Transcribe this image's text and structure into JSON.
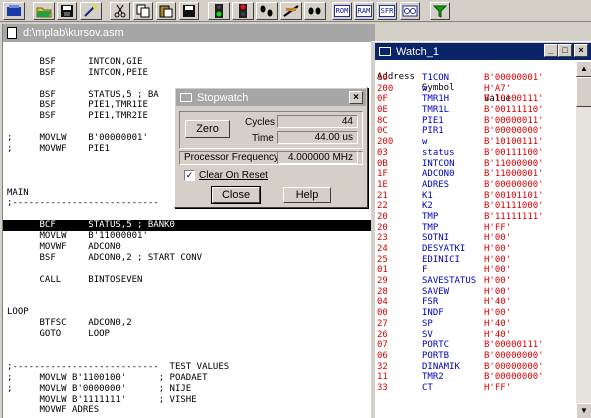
{
  "toolbar": {
    "buttons": [
      {
        "name": "project-button",
        "icon": "project-icon"
      },
      {
        "name": "open-button",
        "icon": "folder-icon"
      },
      {
        "name": "save-button",
        "icon": "disk-icon"
      },
      {
        "name": "find-button",
        "icon": "wand-icon"
      },
      {
        "name": "cut-button",
        "icon": "scissors-icon"
      },
      {
        "name": "copy-button",
        "icon": "copy-icon"
      },
      {
        "name": "paste-button",
        "icon": "paste-icon"
      },
      {
        "name": "save-all-button",
        "icon": "disk-icon"
      },
      {
        "name": "run-button",
        "icon": "traffic-light-green-icon"
      },
      {
        "name": "halt-button",
        "icon": "traffic-light-red-icon"
      },
      {
        "name": "step-button",
        "icon": "footsteps-icon"
      },
      {
        "name": "step-over-button",
        "icon": "step-over-icon"
      },
      {
        "name": "reset-button",
        "icon": "reset-icon"
      }
    ],
    "text_buttons": [
      "ROM",
      "RAM",
      "SFR"
    ],
    "watch_button_icon": "watch-glasses-icon",
    "filter_button_icon": "funnel-icon"
  },
  "editor": {
    "title": "d:\\mplab\\kursov.asm",
    "lines": [
      "",
      "      BSF      INTCON,GIE",
      "      BSF      INTCON,PEIE",
      "",
      "      BSF      STATUS,5 ; BA",
      "      BSF      PIE1,TMR1IE",
      "      BSF      PIE1,TMR2IE",
      "",
      ";     MOVLW    B'00000001'",
      ";     MOVWF    PIE1",
      "",
      "",
      "",
      "MAIN",
      ";---------------------------",
      "",
      "      BCF      STATUS,5 ; BANK0",
      "      MOVLW    B'11000001'",
      "      MOVWF    ADCON0",
      "      BSF      ADCON0,2 ; START CONV",
      "",
      "      CALL     BINTOSEVEN",
      "",
      "",
      "LOOP",
      "      BTFSC    ADCON0,2",
      "      GOTO     LOOP",
      "",
      "",
      ";---------------------------  TEST VALUES",
      ";     MOVLW B'1100100'      ; POADAET",
      ";     MOVLW B'0000000'      ; NIJE",
      "      MOVLW B'1111111'      ; VISHE",
      "      MOVWF ADRES"
    ],
    "selected_line": 16
  },
  "stopwatch": {
    "title": "Stopwatch",
    "zero_label": "Zero",
    "cycles_label": "Cycles",
    "cycles_value": "44",
    "time_label": "Time",
    "time_value": "44.00 us",
    "freq_label": "Processor Frequency",
    "freq_value": "4.000000 MHz",
    "clear_on_reset_label": "Clear On Reset",
    "clear_on_reset_checked": true,
    "close_label": "Close",
    "help_label": "Help"
  },
  "watch": {
    "title": "Watch_1",
    "headers": {
      "address": "Address",
      "symbol": "Symbol",
      "value": "Value"
    },
    "rows": [
      {
        "address": "10",
        "symbol": "T1CON",
        "value": "B'00000001'"
      },
      {
        "address": "200",
        "symbol": "w",
        "value": "H'A7'"
      },
      {
        "address": "0F",
        "symbol": "TMR1H",
        "value": "B'10100111'"
      },
      {
        "address": "0E",
        "symbol": "TMR1L",
        "value": "B'00111110'"
      },
      {
        "address": "8C",
        "symbol": "PIE1",
        "value": "B'00000011'"
      },
      {
        "address": "0C",
        "symbol": "PIR1",
        "value": "B'00000000'"
      },
      {
        "address": "200",
        "symbol": "w",
        "value": "B'10100111'"
      },
      {
        "address": "03",
        "symbol": "status",
        "value": "B'00111100'"
      },
      {
        "address": "0B",
        "symbol": "INTCON",
        "value": "B'11000000'"
      },
      {
        "address": "1F",
        "symbol": "ADCON0",
        "value": "B'11000001'"
      },
      {
        "address": "1E",
        "symbol": "ADRES",
        "value": "B'00000000'"
      },
      {
        "address": "21",
        "symbol": "K1",
        "value": "B'00101101'"
      },
      {
        "address": "22",
        "symbol": "K2",
        "value": "B'01111000'"
      },
      {
        "address": "20",
        "symbol": "TMP",
        "value": "B'11111111'"
      },
      {
        "address": "20",
        "symbol": "TMP",
        "value": "H'FF'"
      },
      {
        "address": "23",
        "symbol": "SOTNI",
        "value": "H'00'"
      },
      {
        "address": "24",
        "symbol": "DESYATKI",
        "value": "H'00'"
      },
      {
        "address": "25",
        "symbol": "EDINICI",
        "value": "H'00'"
      },
      {
        "address": "01",
        "symbol": "F",
        "value": "H'00'"
      },
      {
        "address": "29",
        "symbol": "SAVESTATUS",
        "value": "H'00'"
      },
      {
        "address": "28",
        "symbol": "SAVEW",
        "value": "H'00'"
      },
      {
        "address": "04",
        "symbol": "FSR",
        "value": "H'40'"
      },
      {
        "address": "00",
        "symbol": "INDF",
        "value": "H'00'"
      },
      {
        "address": "27",
        "symbol": "SP",
        "value": "H'40'"
      },
      {
        "address": "26",
        "symbol": "SV",
        "value": "H'40'"
      },
      {
        "address": "07",
        "symbol": "PORTC",
        "value": "B'00000111'"
      },
      {
        "address": "06",
        "symbol": "PORTB",
        "value": "B'00000000'"
      },
      {
        "address": "32",
        "symbol": "DINAMIK",
        "value": "B'00000000'"
      },
      {
        "address": "11",
        "symbol": "TMR2",
        "value": "B'00000000'"
      },
      {
        "address": "33",
        "symbol": "CT",
        "value": "H'FF'"
      }
    ]
  },
  "colors": {
    "watch_address": "#e00000",
    "watch_symbol": "#0000c0",
    "watch_value": "#e00000",
    "active_title": "#0a246a",
    "inactive_title": "#a6a6a6"
  }
}
